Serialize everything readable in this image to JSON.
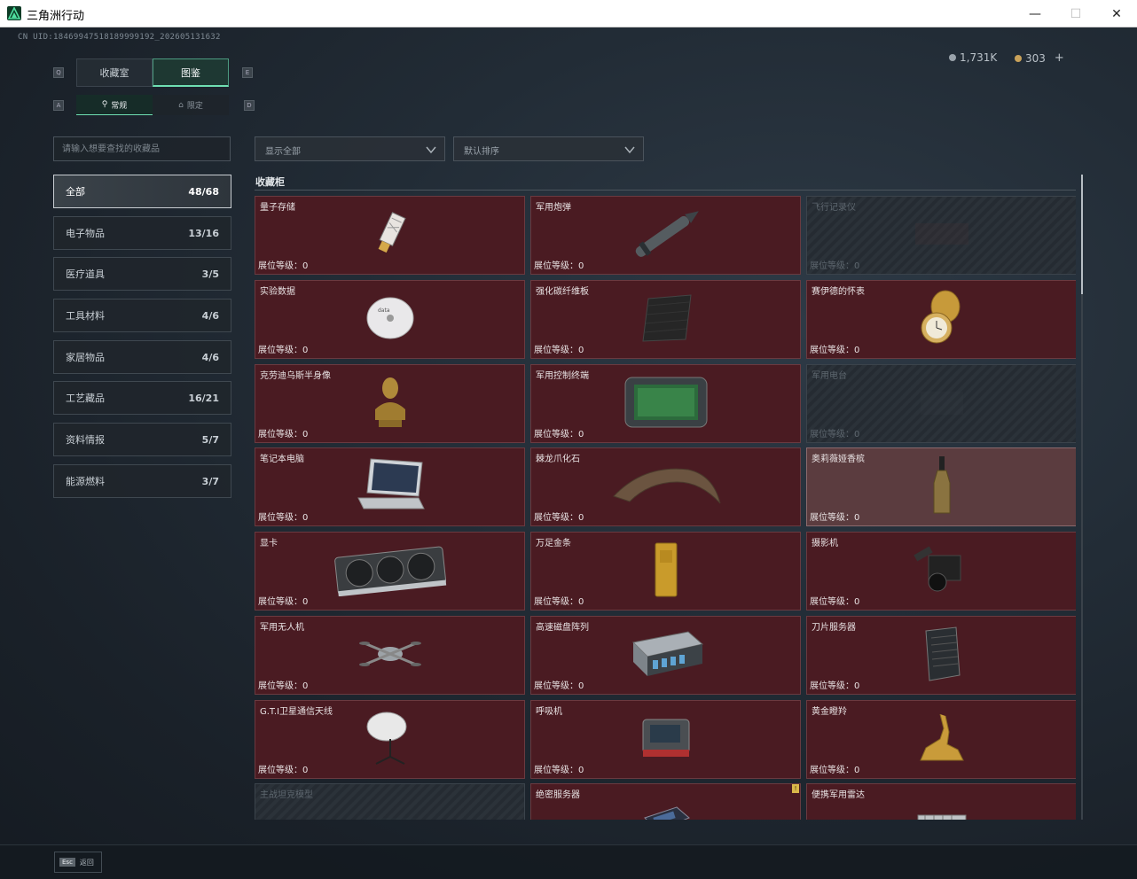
{
  "window": {
    "title": "三角洲行动",
    "minimize": "—",
    "maximize": "☐",
    "close": "✕"
  },
  "header": {
    "uid": "CN UID:18469947518189999192_202605131632",
    "currency1": "1,731K",
    "currency2": "303",
    "plus": "+"
  },
  "tabs": {
    "main": [
      "收藏室",
      "图鉴"
    ],
    "sub": [
      "常规",
      "限定"
    ],
    "key_left_main": "Q",
    "key_right_main": "E",
    "key_left_sub": "A",
    "key_right_sub": "D"
  },
  "search": {
    "placeholder": "请输入想要查找的收藏品"
  },
  "filters": {
    "show": "显示全部",
    "sort": "默认排序"
  },
  "categories": [
    {
      "label": "全部",
      "count": "48/68"
    },
    {
      "label": "电子物品",
      "count": "13/16"
    },
    {
      "label": "医疗道具",
      "count": "3/5"
    },
    {
      "label": "工具材料",
      "count": "4/6"
    },
    {
      "label": "家居物品",
      "count": "4/6"
    },
    {
      "label": "工艺藏品",
      "count": "16/21"
    },
    {
      "label": "资料情报",
      "count": "5/7"
    },
    {
      "label": "能源燃料",
      "count": "3/7"
    }
  ],
  "section": {
    "title": "收藏柜"
  },
  "level_label": "展位等级：0",
  "items": [
    {
      "name": "量子存储",
      "state": "owned",
      "icon": "usb-drive-icon"
    },
    {
      "name": "军用炮弹",
      "state": "owned",
      "icon": "shell-icon"
    },
    {
      "name": "飞行记录仪",
      "state": "locked",
      "icon": "recorder-icon"
    },
    {
      "name": "实验数据",
      "state": "owned",
      "icon": "disc-icon"
    },
    {
      "name": "强化碳纤维板",
      "state": "owned",
      "icon": "carbon-plate-icon"
    },
    {
      "name": "赛伊德的怀表",
      "state": "owned",
      "icon": "pocket-watch-icon"
    },
    {
      "name": "克劳迪乌斯半身像",
      "state": "owned",
      "icon": "bust-icon"
    },
    {
      "name": "军用控制终端",
      "state": "owned",
      "icon": "terminal-icon"
    },
    {
      "name": "军用电台",
      "state": "locked",
      "icon": "radio-icon"
    },
    {
      "name": "笔记本电脑",
      "state": "owned",
      "icon": "laptop-icon"
    },
    {
      "name": "棘龙爪化石",
      "state": "owned",
      "icon": "claw-icon"
    },
    {
      "name": "奥莉薇娅香槟",
      "state": "highlight",
      "icon": "bottle-icon"
    },
    {
      "name": "显卡",
      "state": "owned",
      "icon": "gpu-icon"
    },
    {
      "name": "万足金条",
      "state": "owned",
      "icon": "gold-bar-icon"
    },
    {
      "name": "摄影机",
      "state": "owned",
      "icon": "camera-icon"
    },
    {
      "name": "军用无人机",
      "state": "owned",
      "icon": "drone-icon"
    },
    {
      "name": "高速磁盘阵列",
      "state": "owned",
      "icon": "disk-array-icon"
    },
    {
      "name": "刀片服务器",
      "state": "owned",
      "icon": "server-icon"
    },
    {
      "name": "G.T.I卫星通信天线",
      "state": "owned",
      "icon": "satellite-dish-icon"
    },
    {
      "name": "呼吸机",
      "state": "owned",
      "icon": "ventilator-icon"
    },
    {
      "name": "黄金瞪羚",
      "state": "owned",
      "icon": "gazelle-icon"
    },
    {
      "name": "主战坦克模型",
      "state": "locked",
      "icon": "tank-icon"
    },
    {
      "name": "绝密服务器",
      "state": "owned",
      "icon": "secret-server-icon",
      "badge": "!"
    },
    {
      "name": "便携军用雷达",
      "state": "owned",
      "icon": "radar-icon"
    }
  ],
  "footer": {
    "esc_key": "Esc",
    "esc_label": "返回"
  },
  "colors": {
    "accent": "#6fe0b3",
    "owned_card": "#4a1b22",
    "locked_card": "#252b32"
  }
}
